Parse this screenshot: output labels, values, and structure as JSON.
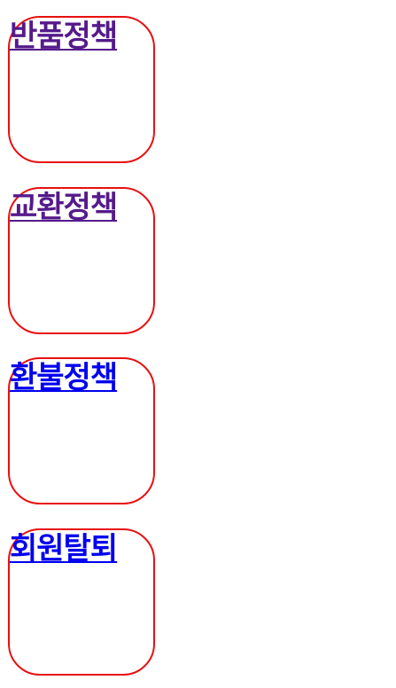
{
  "policies": [
    {
      "label": "반품정책",
      "state": "visited"
    },
    {
      "label": "교환정책",
      "state": "visited"
    },
    {
      "label": "환불정책",
      "state": "unvisited"
    },
    {
      "label": "회원탈퇴",
      "state": "unvisited"
    }
  ],
  "colors": {
    "border": "#e81010",
    "link_visited": "#551a8b",
    "link_unvisited": "#0000ee"
  }
}
